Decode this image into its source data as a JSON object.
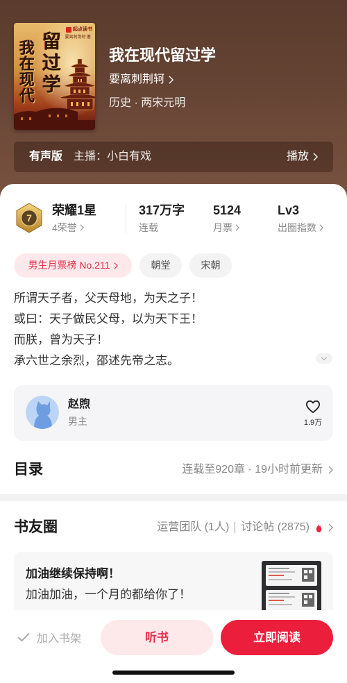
{
  "book": {
    "title": "我在现代留过学",
    "author": "要离刺荆轲",
    "genre": "历史 · 两宋元明",
    "cover": {
      "title_columns": [
        "我在现代",
        "留过学"
      ],
      "brand": "起点读书",
      "byline": "要离刺荆轲 著"
    }
  },
  "audio_edition": {
    "label": "有声版",
    "narrator": "主播：小白有戏",
    "play_label": "播放"
  },
  "stats": {
    "honor": {
      "level": "7",
      "title": "荣耀1星",
      "count": "4荣誉"
    },
    "word_count": {
      "value": "317万字",
      "label": "连载"
    },
    "monthly_tickets": {
      "value": "5124",
      "label": "月票"
    },
    "influence": {
      "value": "Lv3",
      "label": "出圈指数"
    }
  },
  "tags": {
    "rank": "男生月票榜 No.211",
    "items": [
      "朝堂",
      "宋朝"
    ]
  },
  "synopsis": [
    "所谓天子者，父天母地，为天之子！",
    "或曰：天子做民父母，以为天下王！",
    "而朕，曾为天子！",
    "承六世之余烈，邵述先帝之志。"
  ],
  "character": {
    "name": "赵煦",
    "role": "男主",
    "likes": "1.9万"
  },
  "catalog": {
    "title": "目录",
    "status": "连载至920章 · 19小时前更新"
  },
  "community": {
    "title": "书友圈",
    "team": "运营团队 (1人)",
    "threads": "讨论帖 (2875)",
    "post": {
      "title": "加油继续保持啊！",
      "body": "加油加油，一个月的都给你了！"
    }
  },
  "bottom_bar": {
    "add_shelf": "加入书架",
    "listen": "听书",
    "read": "立即阅读"
  },
  "colors": {
    "header_bg": "#684535",
    "accent": "#eb1f3c",
    "accent_text": "#e4314b",
    "accent_soft": "#fde9eb",
    "muted_text": "#888888",
    "card_bg": "#f5f5f7"
  },
  "icons": {
    "honor_badge": "hexagon-medal-icon",
    "chevron": "chevron-right-icon",
    "expand": "chevron-down-icon",
    "like": "heart-outline-icon",
    "hot": "flame-icon",
    "shelf": "check-icon"
  }
}
